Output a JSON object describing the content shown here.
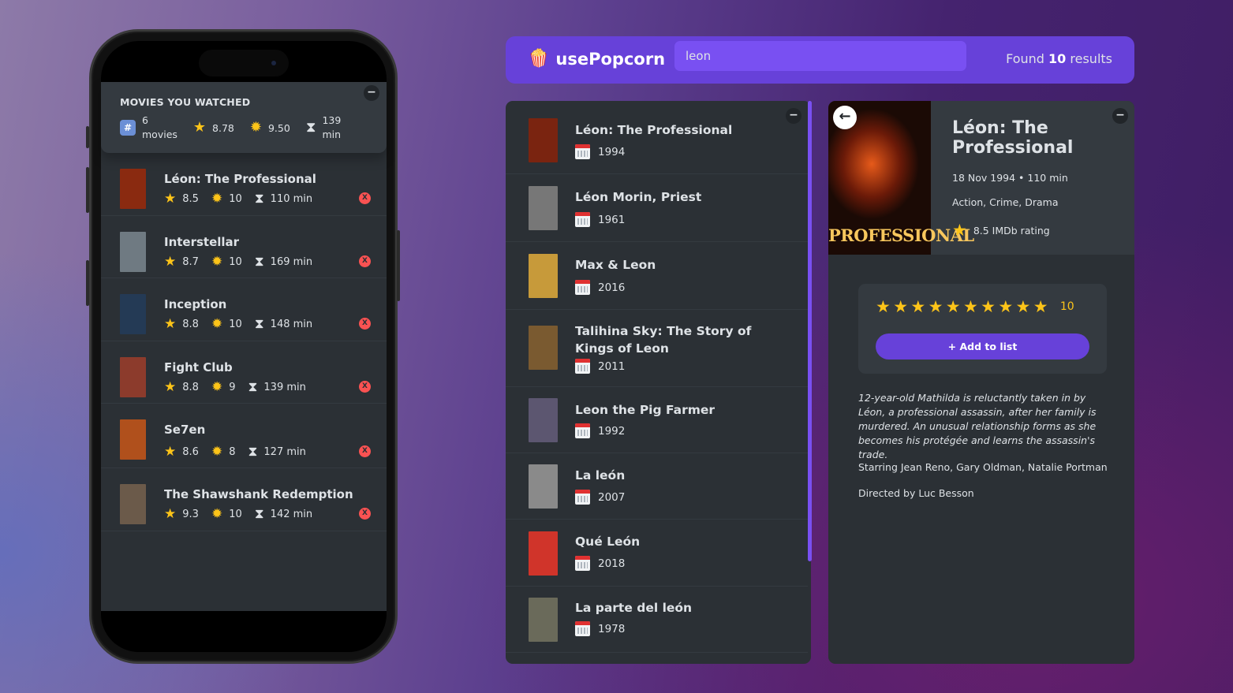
{
  "colors": {
    "accent": "#6741d9",
    "accent_light": "#7950f2",
    "star": "#fcc419",
    "danger": "#fa5252",
    "bg_box": "#2b3035",
    "bg_elevated": "#343a40"
  },
  "watched": {
    "heading": "Movies you watched",
    "summary": {
      "movies_count": "6",
      "movies_label": "movies",
      "avg_imdb": "8.78",
      "avg_user": "9.50",
      "avg_runtime": "139",
      "runtime_unit": "min"
    },
    "items": [
      {
        "title": "Léon: The Professional",
        "imdb": "8.5",
        "user": "10",
        "runtime": "110 min",
        "poster_color": "#8a2a10"
      },
      {
        "title": "Interstellar",
        "imdb": "8.7",
        "user": "10",
        "runtime": "169 min",
        "poster_color": "#6f7a82"
      },
      {
        "title": "Inception",
        "imdb": "8.8",
        "user": "10",
        "runtime": "148 min",
        "poster_color": "#243a55"
      },
      {
        "title": "Fight Club",
        "imdb": "8.8",
        "user": "9",
        "runtime": "139 min",
        "poster_color": "#8c3b2c"
      },
      {
        "title": "Se7en",
        "imdb": "8.6",
        "user": "8",
        "runtime": "127 min",
        "poster_color": "#b0501c"
      },
      {
        "title": "The Shawshank Redemption",
        "imdb": "9.3",
        "user": "10",
        "runtime": "142 min",
        "poster_color": "#6b5a4a"
      }
    ]
  },
  "nav": {
    "logo_icon": "popcorn-icon",
    "logo_text": "usePopcorn",
    "search_value": "leon",
    "found_prefix": "Found",
    "found_count": "10",
    "found_suffix": "results"
  },
  "results": [
    {
      "title": "Léon: The Professional",
      "year": "1994",
      "poster_color": "#7a2410"
    },
    {
      "title": "Léon Morin, Priest",
      "year": "1961",
      "poster_color": "#777777"
    },
    {
      "title": "Max & Leon",
      "year": "2016",
      "poster_color": "#c79a3a"
    },
    {
      "title": "Talihina Sky: The Story of Kings of Leon",
      "year": "2011",
      "poster_color": "#7a5a30"
    },
    {
      "title": "Leon the Pig Farmer",
      "year": "1992",
      "poster_color": "#5c5670"
    },
    {
      "title": "La león",
      "year": "2007",
      "poster_color": "#8a8a8a"
    },
    {
      "title": "Qué León",
      "year": "2018",
      "poster_color": "#d0342a"
    },
    {
      "title": "La parte del león",
      "year": "1978",
      "poster_color": "#6a6a5a"
    }
  ],
  "detail": {
    "title": "Léon: The Professional",
    "poster_text": "PROFESSIONAL",
    "released": "18 Nov 1994",
    "runtime": "110 min",
    "genre": "Action, Crime, Drama",
    "imdb_rating_text": "8.5 IMDb rating",
    "user_rating": "10",
    "star_count": 10,
    "add_button": "+ Add to list",
    "plot": "12-year-old Mathilda is reluctantly taken in by Léon, a professional assassin, after her family is murdered. An unusual relationship forms as she becomes his protégée and learns the assassin's trade.",
    "starring": "Starring Jean Reno, Gary Oldman, Natalie Portman",
    "directed": "Directed by Luc Besson"
  }
}
